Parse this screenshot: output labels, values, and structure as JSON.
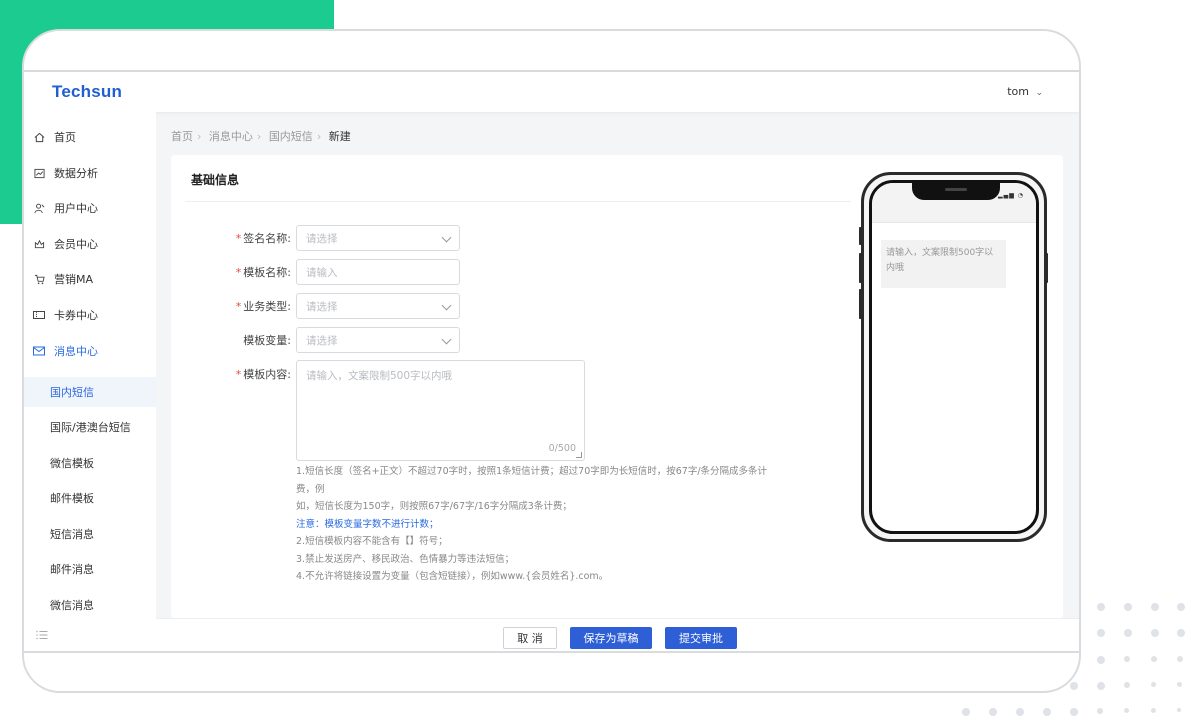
{
  "brand": "Techsun",
  "user": {
    "name": "tom",
    "chevron": "⌄"
  },
  "sidebar": {
    "items": [
      {
        "label": "首页",
        "icon": "home-icon"
      },
      {
        "label": "数据分析",
        "icon": "chart-icon"
      },
      {
        "label": "用户中心",
        "icon": "users-icon"
      },
      {
        "label": "会员中心",
        "icon": "crown-icon"
      },
      {
        "label": "营销MA",
        "icon": "cart-icon"
      },
      {
        "label": "卡券中心",
        "icon": "ticket-icon"
      },
      {
        "label": "消息中心",
        "icon": "mail-icon"
      }
    ],
    "sub_items": [
      "国内短信",
      "国际/港澳台短信",
      "微信模板",
      "邮件模板",
      "短信消息",
      "邮件消息",
      "微信消息"
    ],
    "collapse_icon": "list-icon"
  },
  "breadcrumb": [
    "首页",
    "消息中心",
    "国内短信",
    "新建"
  ],
  "form": {
    "section_title": "基础信息",
    "signature": {
      "label": "签名名称:",
      "placeholder": "请选择"
    },
    "template_name": {
      "label": "模板名称:",
      "placeholder": "请输入"
    },
    "business_type": {
      "label": "业务类型:",
      "placeholder": "请选择"
    },
    "variable": {
      "label": "模板变量:",
      "placeholder": "请选择"
    },
    "content": {
      "label": "模板内容:",
      "placeholder": "请输入，文案限制500字以内哦",
      "count": "0/500"
    }
  },
  "notes": [
    "1.短信长度（签名+正文）不超过70字时，按照1条短信计费；超过70字即为长短信时，按67字/条分隔成多条计费，例",
    "如，短信长度为150字，则按照67字/67字/16字分隔成3条计费；",
    "注意：模板变量字数不进行计数；",
    "2.短信模板内容不能含有【】符号；",
    "3.禁止发送房产、移民政治、色情暴力等违法短信；",
    "4.不允许将链接设置为变量（包含短链接），例如www.{会员姓名}.com。"
  ],
  "phone": {
    "preview_text": "请输入，文案限制500字以内哦",
    "status": "▂▄▆ ◔"
  },
  "footer": {
    "cancel": "取 消",
    "save_draft": "保存为草稿",
    "submit": "提交审批"
  },
  "colors": {
    "accent": "#2f5fd6",
    "brand": "#1f5fd1",
    "green": "#1ccb8f",
    "required": "#e24a3b"
  }
}
